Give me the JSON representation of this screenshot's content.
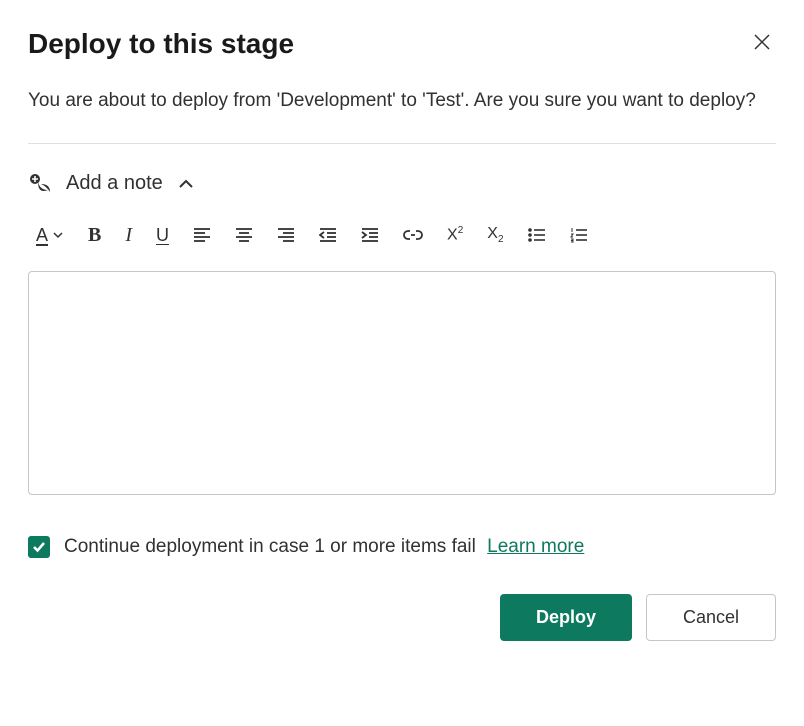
{
  "dialog": {
    "title": "Deploy to this stage",
    "description": "You are about to deploy from 'Development' to 'Test'. Are you sure you want to deploy?"
  },
  "note": {
    "label": "Add a note",
    "value": ""
  },
  "toolbar": {
    "fontColor": "A",
    "bold": "B",
    "italic": "I",
    "underline": "U",
    "superscript": "X",
    "superscriptExp": "2",
    "subscript": "X",
    "subscriptIdx": "2"
  },
  "checkbox": {
    "checked": true,
    "label": "Continue deployment in case 1 or more items fail",
    "learnMore": "Learn more"
  },
  "buttons": {
    "primary": "Deploy",
    "secondary": "Cancel"
  }
}
